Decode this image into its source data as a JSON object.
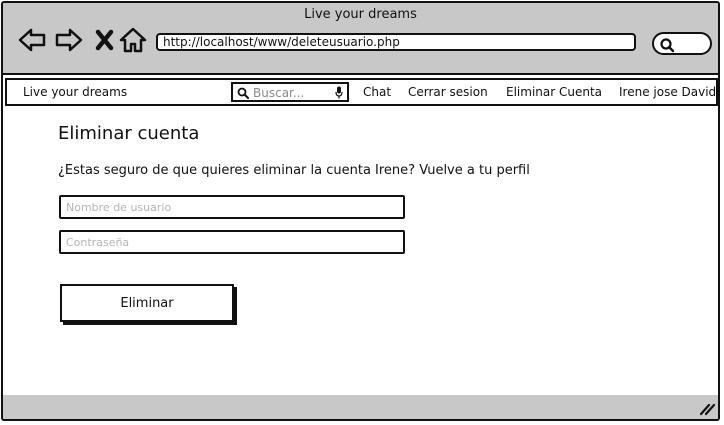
{
  "window": {
    "title": "Live your dreams",
    "url": "http://localhost/www/deleteusuario.php"
  },
  "nav": {
    "back_icon": "arrow-left-icon",
    "forward_icon": "arrow-right-icon",
    "stop_icon": "close-icon",
    "home_icon": "home-icon"
  },
  "menubar": {
    "brand": "Live your dreams",
    "search_placeholder": "Buscar...",
    "items": [
      {
        "label": "Chat"
      },
      {
        "label": "Cerrar sesion"
      },
      {
        "label": "Eliminar Cuenta"
      },
      {
        "label": "Irene jose David"
      }
    ]
  },
  "content": {
    "heading": "Eliminar cuenta",
    "message": "¿Estas seguro de que quieres eliminar la cuenta Irene?  Vuelve a tu perfil",
    "username_placeholder": "Nombre de usuario",
    "username_value": "",
    "password_placeholder": "Contraseña",
    "password_value": "",
    "delete_button": "Eliminar"
  }
}
